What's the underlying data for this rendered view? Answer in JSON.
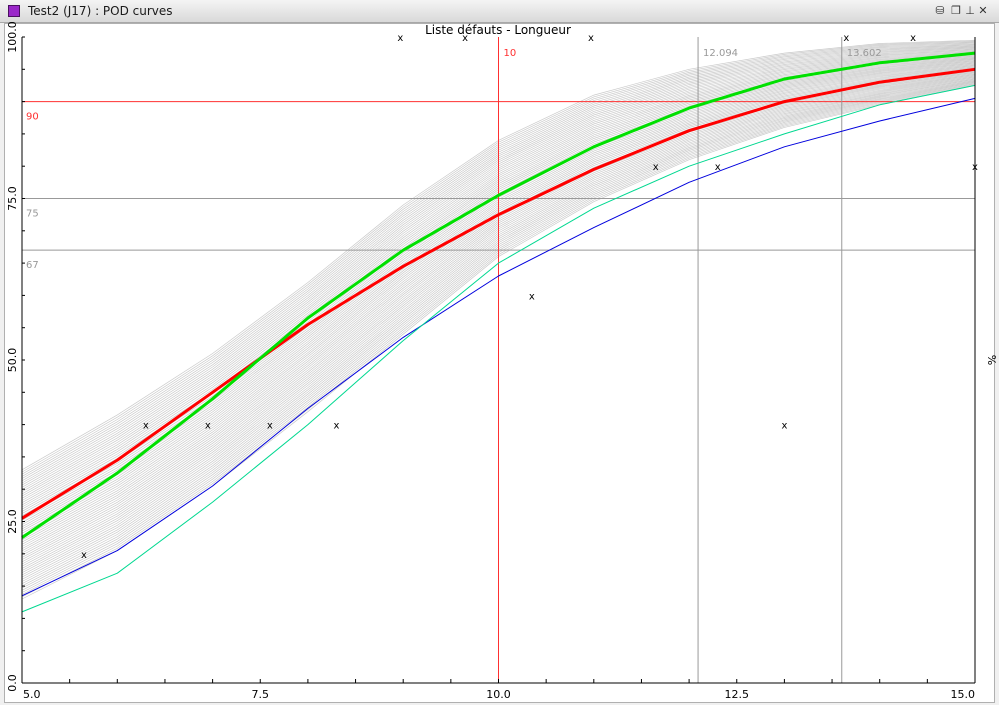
{
  "window": {
    "title": "Test2 (J17) : POD curves",
    "controls": [
      {
        "name": "database-icon",
        "glyph": "⛁"
      },
      {
        "name": "restore-icon",
        "glyph": "❐"
      },
      {
        "name": "pin-icon",
        "glyph": "⊥"
      },
      {
        "name": "close-icon",
        "glyph": "✕"
      }
    ]
  },
  "chart_data": {
    "type": "line",
    "title": "Liste défauts - Longueur",
    "xlabel": "",
    "ylabel": "%",
    "xlim": [
      5,
      15
    ],
    "ylim": [
      0,
      100
    ],
    "x_ticks": [
      "5.0",
      "7.5",
      "10.0",
      "12.5",
      "15.0"
    ],
    "y_ticks": [
      "0.0",
      "25.0",
      "50.0",
      "75.0",
      "100.0"
    ],
    "grid": false,
    "legend": "none",
    "reference_lines": [
      {
        "axis": "y",
        "value": 90,
        "label": "90",
        "color": "#ff3030"
      },
      {
        "axis": "y",
        "value": 75,
        "label": "75",
        "color": "#999999"
      },
      {
        "axis": "y",
        "value": 67,
        "label": "67",
        "color": "#999999"
      },
      {
        "axis": "x",
        "value": 10,
        "label": "10",
        "color": "#ff3030"
      },
      {
        "axis": "x",
        "value": 12.094,
        "label": "12.094",
        "color": "#999999"
      },
      {
        "axis": "x",
        "value": 13.602,
        "label": "13.602",
        "color": "#999999"
      }
    ],
    "series": [
      {
        "color": "#00e000",
        "width": 3,
        "x": [
          5,
          6,
          7,
          8,
          9,
          10,
          11,
          12,
          13,
          14,
          15
        ],
        "y": [
          22.5,
          32.5,
          44.0,
          56.5,
          67.0,
          75.5,
          83.0,
          89.0,
          93.5,
          96.0,
          97.5
        ]
      },
      {
        "color": "#ff0000",
        "width": 3,
        "x": [
          5,
          6,
          7,
          8,
          9,
          10,
          11,
          12,
          13,
          14,
          15
        ],
        "y": [
          25.5,
          34.5,
          45.0,
          55.5,
          64.5,
          72.5,
          79.5,
          85.5,
          90.0,
          93.0,
          95.0
        ]
      },
      {
        "color": "#00d890",
        "width": 1,
        "x": [
          5,
          6,
          7,
          8,
          9,
          10,
          11,
          12,
          13,
          14,
          15
        ],
        "y": [
          11.0,
          17.0,
          28.0,
          40.0,
          53.0,
          65.0,
          73.5,
          80.0,
          85.0,
          89.5,
          92.5
        ]
      },
      {
        "color": "#0000dd",
        "width": 1,
        "x": [
          5,
          6,
          7,
          8,
          9,
          10,
          11,
          12,
          13,
          14,
          15
        ],
        "y": [
          13.5,
          20.5,
          30.5,
          42.5,
          53.5,
          63.0,
          70.5,
          77.5,
          83.0,
          87.0,
          90.5
        ]
      }
    ],
    "band": {
      "color": "#b8b8b8",
      "x": [
        5,
        6,
        7,
        8,
        9,
        10,
        11,
        12,
        13,
        14,
        15
      ],
      "lower": [
        13.0,
        20.5,
        30.5,
        42.0,
        54.0,
        66.0,
        74.5,
        81.0,
        86.0,
        89.5,
        92.5
      ],
      "upper": [
        33.0,
        41.5,
        51.0,
        62.0,
        74.0,
        84.0,
        91.0,
        95.0,
        97.5,
        99.0,
        99.5
      ]
    },
    "points": [
      {
        "x": 5.65,
        "y": 20.0
      },
      {
        "x": 6.3,
        "y": 40.0
      },
      {
        "x": 6.95,
        "y": 40.0
      },
      {
        "x": 7.6,
        "y": 40.0
      },
      {
        "x": 8.3,
        "y": 40.0
      },
      {
        "x": 10.35,
        "y": 60.0
      },
      {
        "x": 11.65,
        "y": 80.0
      },
      {
        "x": 12.3,
        "y": 80.0
      },
      {
        "x": 13.0,
        "y": 40.0
      },
      {
        "x": 15.0,
        "y": 80.0
      },
      {
        "x": 8.97,
        "y": 100.0
      },
      {
        "x": 9.65,
        "y": 100.0
      },
      {
        "x": 10.97,
        "y": 100.0
      },
      {
        "x": 13.65,
        "y": 100.0
      },
      {
        "x": 14.35,
        "y": 100.0
      }
    ],
    "point_marker": "x"
  }
}
